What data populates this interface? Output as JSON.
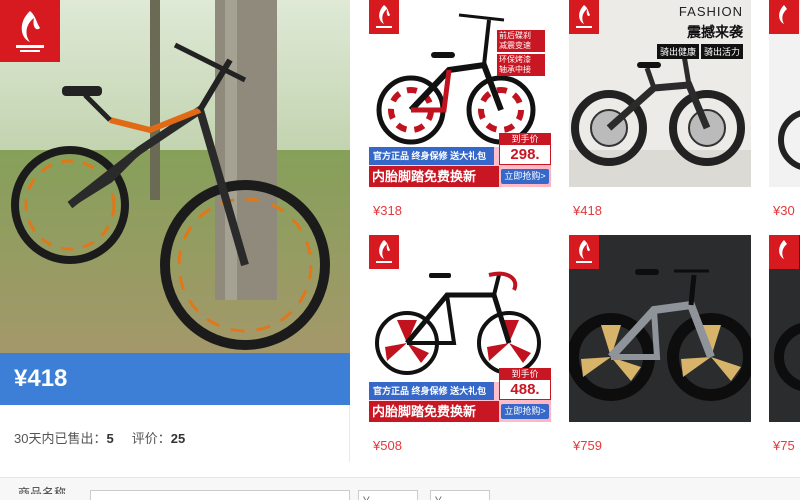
{
  "featured": {
    "price": "¥418",
    "sold_label": "30天内已售出：",
    "sold_count": "5",
    "review_label": "评价：",
    "review_count": "25"
  },
  "products": [
    {
      "price": "¥318",
      "promo": {
        "badge_top": "到手价",
        "badge_price": "298.",
        "line1": "官方正品",
        "line2": "终身保修",
        "line3": "送大礼包",
        "big": "内胎脚踏免费换新",
        "btn": "立即抢购>",
        "tag1": "前后碟刹",
        "tag2": "减震变速",
        "tag3": "环保烤漆",
        "tag4": "轴承中接"
      }
    },
    {
      "price": "¥418",
      "banner_top": "FASHION",
      "banner_main": "震撼来袭",
      "pill1": "骑出健康",
      "pill2": "骑出活力"
    },
    {
      "price": "¥30"
    },
    {
      "price": "¥508",
      "promo": {
        "badge_top": "到手价",
        "badge_price": "488.",
        "line1": "官方正品",
        "line2": "终身保修",
        "line3": "送大礼包",
        "big": "内胎脚踏免费换新",
        "btn": "立即抢购>"
      }
    },
    {
      "price": "¥759"
    },
    {
      "price": "¥75"
    }
  ],
  "bottom": {
    "label": "商品名称",
    "input1_placeholder": "",
    "input2_placeholder": "¥",
    "input3_placeholder": "¥"
  },
  "colors": {
    "accent_blue": "#3d7fd6",
    "price_red": "#e4393c",
    "brand_red": "#d71920"
  }
}
